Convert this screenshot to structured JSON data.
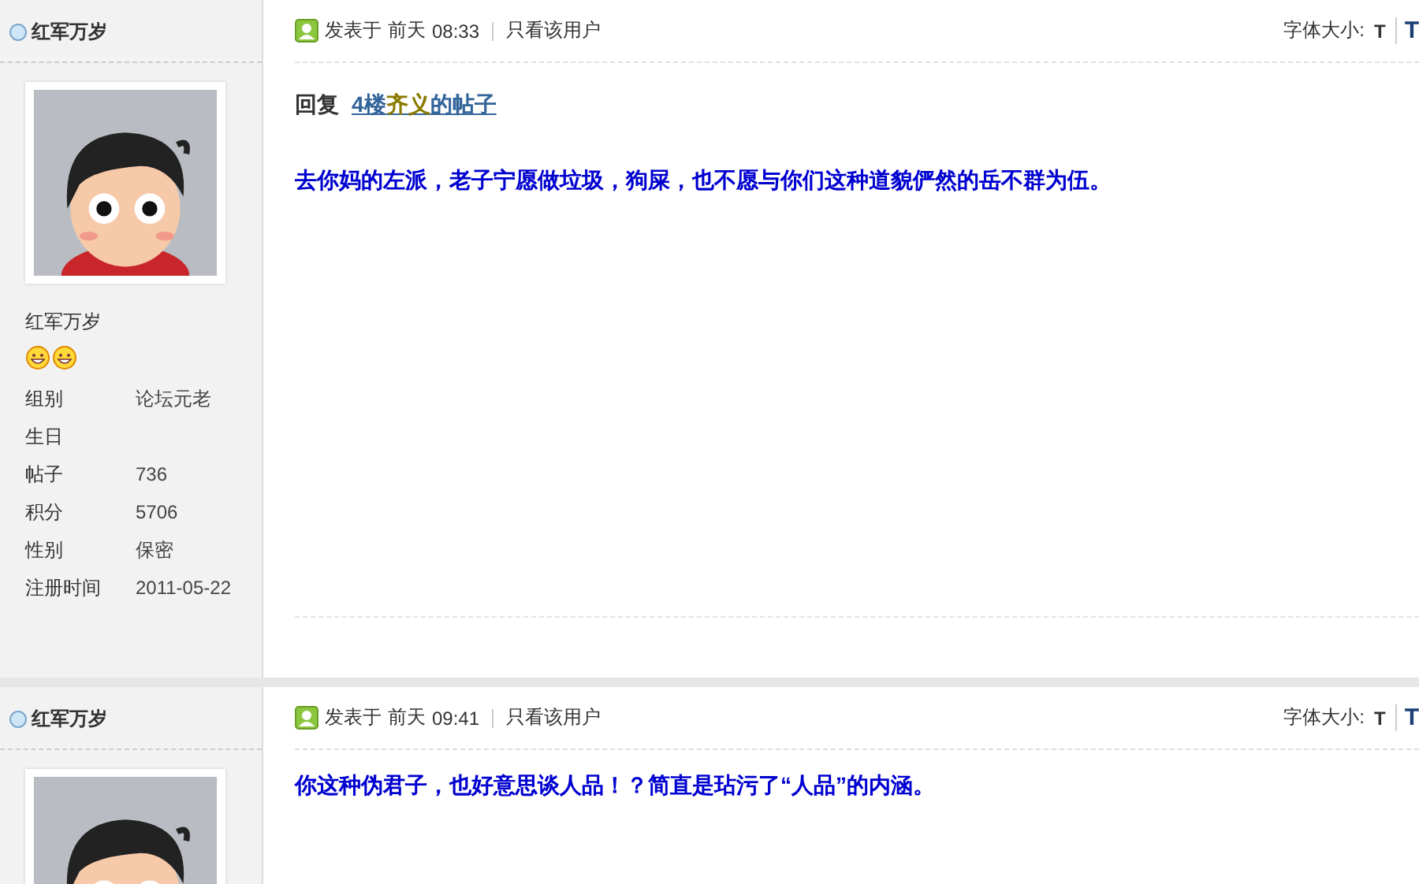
{
  "posts": [
    {
      "author": "红军万岁",
      "posted_label": "发表于",
      "day": "前天",
      "time": "08:33",
      "only_user_link": "只看该用户",
      "font_size_label": "字体大小:",
      "font_sizes": [
        "T",
        "T"
      ],
      "reply": {
        "label": "回复",
        "floor": "4楼",
        "name": "齐义",
        "suffix": "的帖子"
      },
      "body": "去你妈的左派，老子宁愿做垃圾，狗屎，也不愿与你们这种道貌俨然的岳不群为伍。",
      "profile": {
        "name": "红军万岁",
        "medals": [
          {
            "kind": "smiley"
          },
          {
            "kind": "smiley"
          }
        ],
        "fields": [
          {
            "label": "组别",
            "value": "论坛元老"
          },
          {
            "label": "生日"
          },
          {
            "label": "帖子",
            "value": "736"
          },
          {
            "label": "积分",
            "value": "5706"
          },
          {
            "label": "性别",
            "value": "保密"
          },
          {
            "label": "注册时间",
            "value": "2011-05-22"
          }
        ]
      }
    },
    {
      "author": "红军万岁",
      "posted_label": "发表于",
      "day": "前天",
      "time": "09:41",
      "only_user_link": "只看该用户",
      "font_size_label": "字体大小:",
      "font_sizes": [
        "T",
        "T"
      ],
      "body": "你这种伪君子，也好意思谈人品！？简直是玷污了“人品”的内涵。"
    }
  ]
}
